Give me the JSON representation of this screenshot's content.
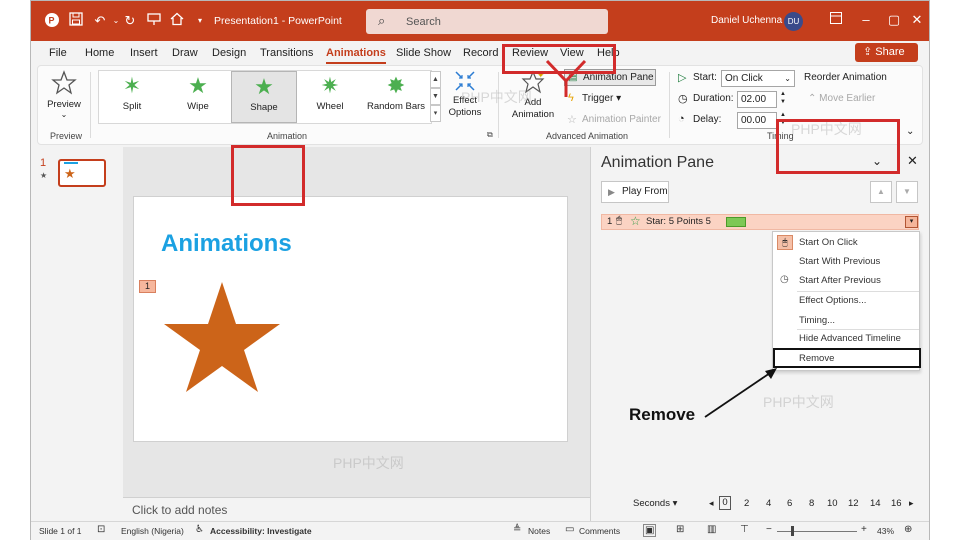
{
  "app": {
    "title": "Presentation1 - PowerPoint",
    "user_name": "Daniel Uchenna",
    "user_initials": "DU",
    "search_placeholder": "Search",
    "accent": "#c43e1c"
  },
  "tabs": [
    "File",
    "Home",
    "Insert",
    "Draw",
    "Design",
    "Transitions",
    "Animations",
    "Slide Show",
    "Record",
    "Review",
    "View",
    "Help"
  ],
  "active_tab": "Animations",
  "share_label": "Share",
  "ribbon": {
    "preview_label": "Preview",
    "preview_group": "Preview",
    "gallery": [
      {
        "label": "Split",
        "icon": "star-split-icon"
      },
      {
        "label": "Wipe",
        "icon": "star-wipe-icon"
      },
      {
        "label": "Shape",
        "icon": "star-shape-icon",
        "selected": true
      },
      {
        "label": "Wheel",
        "icon": "star-wheel-icon"
      },
      {
        "label": "Random Bars",
        "icon": "star-random-bars-icon"
      }
    ],
    "effect_options": "Effect Options",
    "animation_group": "Animation",
    "add_animation": "Add Animation",
    "animation_pane": "Animation Pane",
    "trigger": "Trigger",
    "animation_painter": "Animation Painter",
    "advanced_group": "Advanced Animation",
    "start_label": "Start:",
    "start_value": "On Click",
    "duration_label": "Duration:",
    "duration_value": "02.00",
    "delay_label": "Delay:",
    "delay_value": "00.00",
    "reorder": "Reorder Animation",
    "move_earlier": "Move Earlier",
    "timing_group": "Timing"
  },
  "slides": {
    "number": "1"
  },
  "slide": {
    "title": "Animations",
    "anim_tag": "1",
    "star_color": "#cc6419"
  },
  "notes_placeholder": "Click to add notes",
  "pane": {
    "title": "Animation Pane",
    "play_from": "Play From",
    "item_number": "1",
    "item_label": "Star: 5 Points 5",
    "menu": [
      "Start On Click",
      "Start With Previous",
      "Start After Previous",
      "Effect Options...",
      "Timing...",
      "Hide Advanced Timeline",
      "Remove"
    ],
    "seconds_label": "Seconds",
    "timeline_ticks": [
      "0",
      "2",
      "4",
      "6",
      "8",
      "10",
      "12",
      "14",
      "16"
    ]
  },
  "annotation": {
    "callout": "Remove",
    "watermark": "PHP中文网"
  },
  "status": {
    "slide_of": "Slide 1 of 1",
    "language": "English (Nigeria)",
    "accessibility": "Accessibility: Investigate",
    "notes": "Notes",
    "comments": "Comments",
    "zoom": "43%"
  }
}
